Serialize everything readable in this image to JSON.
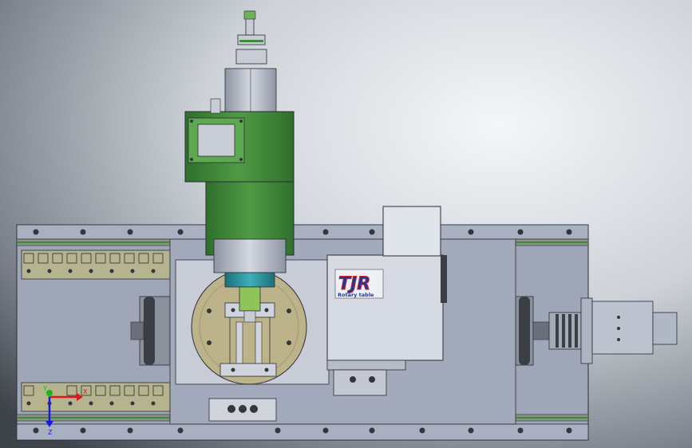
{
  "logo": {
    "brand": "TJR",
    "subtitle": "Rotary table"
  },
  "triad": {
    "x_label": "X",
    "y_label": "Y",
    "z_label": "Z"
  },
  "colors": {
    "background_light": "#e8ecf0",
    "background_dark": "#4a4f57",
    "base_plate": "#9ea6b8",
    "spindle_green": "#3e8a3a",
    "spindle_green_light": "#5aa84e",
    "table_disk": "#bdb38a",
    "logo_red": "#d0202a",
    "logo_blue": "#1a3a9a",
    "axis_x": "#e01818",
    "axis_y": "#18b818",
    "axis_z": "#1818e0"
  }
}
